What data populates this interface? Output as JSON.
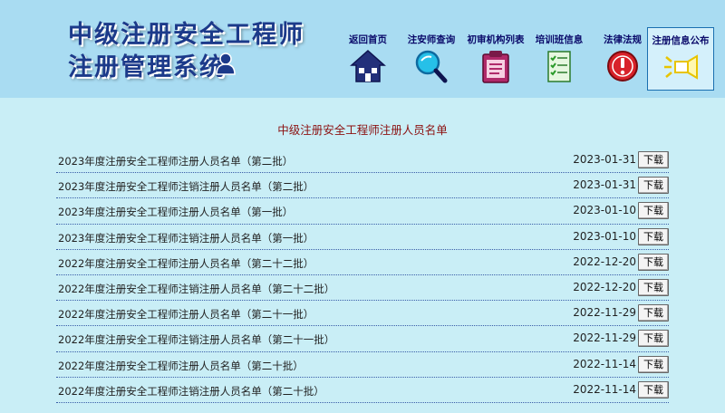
{
  "header": {
    "logo_line1": "中级注册安全工程师",
    "logo_line2": "注册管理系统"
  },
  "nav": [
    {
      "label": "返回首页",
      "icon": "home-icon"
    },
    {
      "label": "注安师查询",
      "icon": "search-icon"
    },
    {
      "label": "初审机构列表",
      "icon": "clipboard-icon"
    },
    {
      "label": "培训班信息",
      "icon": "checklist-icon"
    },
    {
      "label": "法律法规",
      "icon": "alert-icon"
    },
    {
      "label": "注册信息公布",
      "icon": "megaphone-icon",
      "active": true
    }
  ],
  "list": {
    "title": "中级注册安全工程师注册人员名单",
    "download_label": "下载",
    "rows": [
      {
        "name": "2023年度注册安全工程师注册人员名单（第二批）",
        "date": "2023-01-31"
      },
      {
        "name": "2023年度注册安全工程师注销注册人员名单（第二批）",
        "date": "2023-01-31"
      },
      {
        "name": "2023年度注册安全工程师注册人员名单（第一批）",
        "date": "2023-01-10"
      },
      {
        "name": "2023年度注册安全工程师注销注册人员名单（第一批）",
        "date": "2023-01-10"
      },
      {
        "name": "2022年度注册安全工程师注册人员名单（第二十二批）",
        "date": "2022-12-20"
      },
      {
        "name": "2022年度注册安全工程师注销注册人员名单（第二十二批）",
        "date": "2022-12-20"
      },
      {
        "name": "2022年度注册安全工程师注册人员名单（第二十一批）",
        "date": "2022-11-29"
      },
      {
        "name": "2022年度注册安全工程师注销注册人员名单（第二十一批）",
        "date": "2022-11-29"
      },
      {
        "name": "2022年度注册安全工程师注册人员名单（第二十批）",
        "date": "2022-11-14"
      },
      {
        "name": "2022年度注册安全工程师注销注册人员名单（第二十批）",
        "date": "2022-11-14"
      }
    ]
  }
}
